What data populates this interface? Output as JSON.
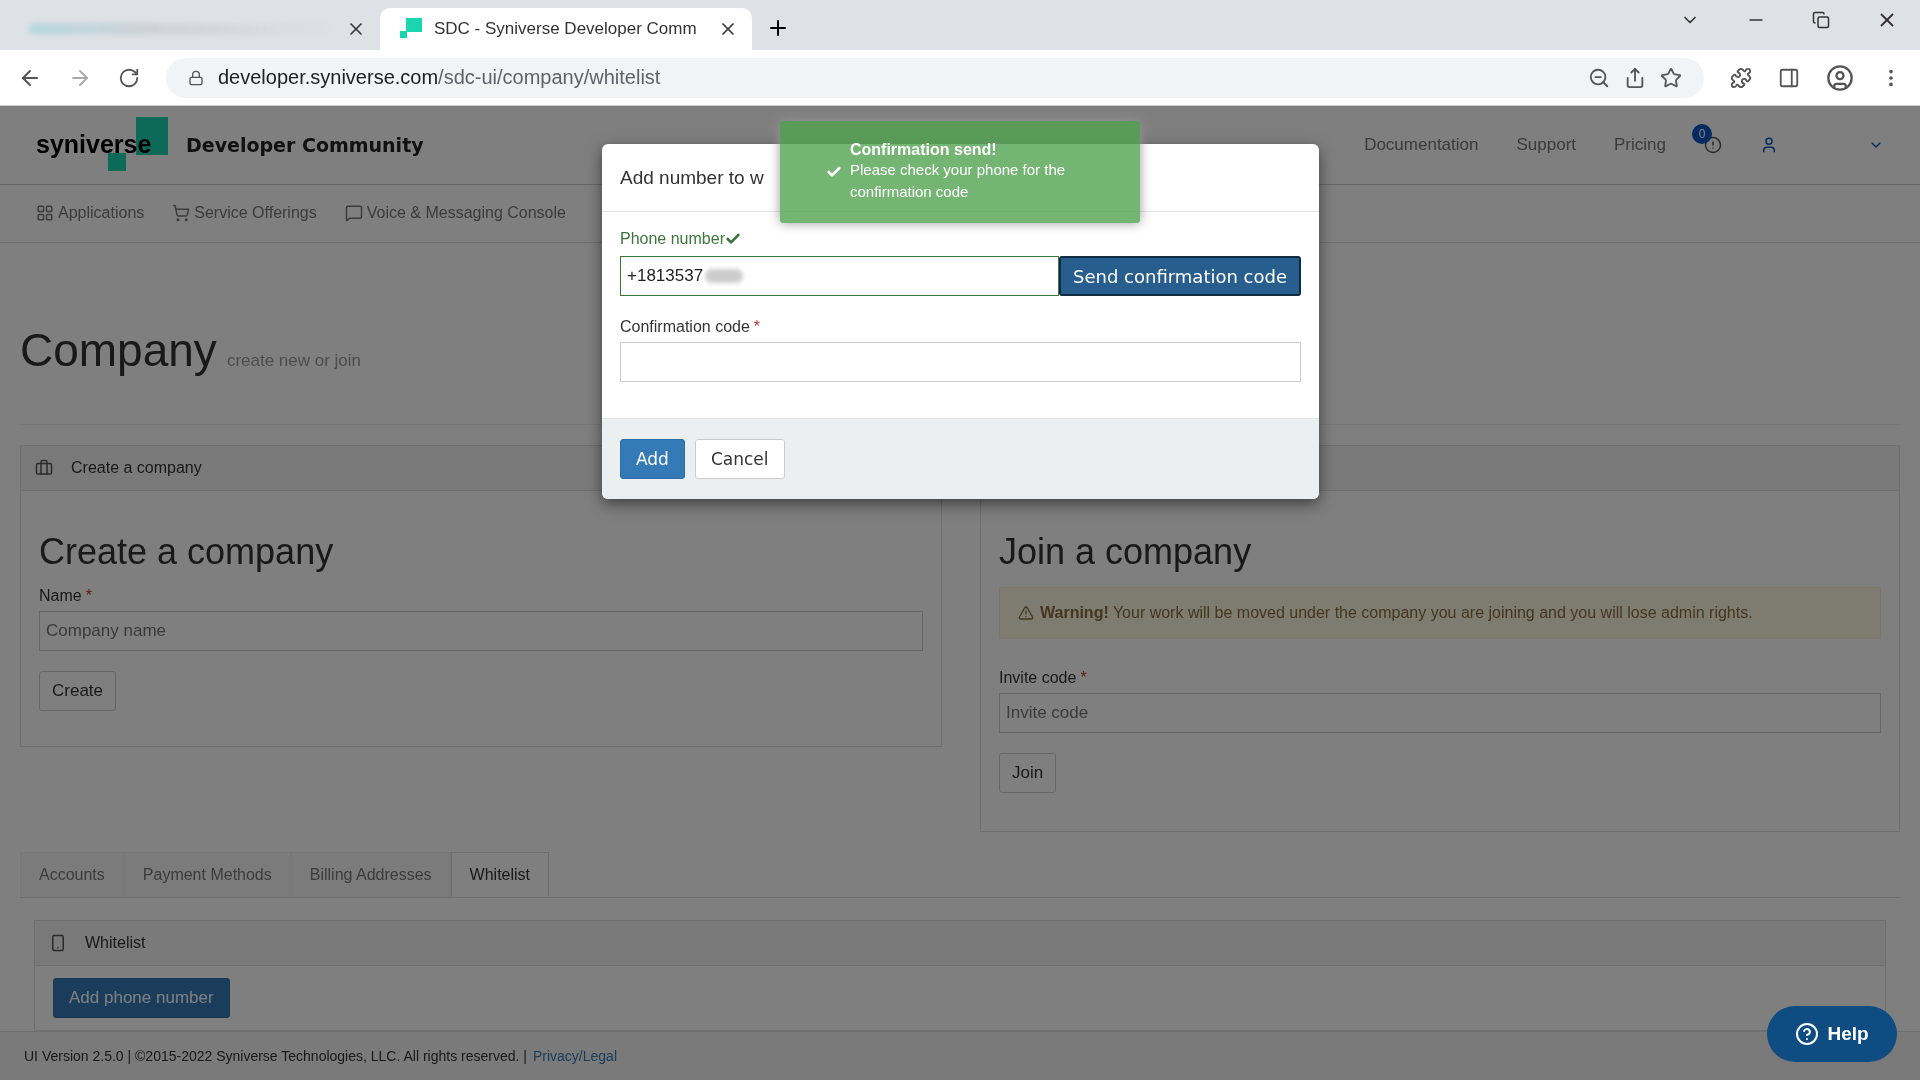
{
  "browser": {
    "tabs": [
      {
        "selected": false
      },
      {
        "title": "SDC - Syniverse Developer Comm",
        "selected": true
      }
    ],
    "url_host": "developer.syniverse.com",
    "url_path": "/sdc-ui/company/whitelist"
  },
  "header": {
    "logo": "syniverse",
    "title": "Developer Community",
    "links": [
      "Documentation",
      "Support",
      "Pricing"
    ],
    "notification_count": "0"
  },
  "nav": [
    {
      "kind": "grid",
      "label": "Applications"
    },
    {
      "kind": "cart",
      "label": "Service Offerings"
    },
    {
      "kind": "chat",
      "label": "Voice & Messaging Console"
    }
  ],
  "page_title": "Company",
  "page_subtitle": "create new or join",
  "create_panel": {
    "heading": "Create a company",
    "title": "Create a company",
    "name_label": "Name",
    "required_mark": "*",
    "placeholder": "Company name",
    "button": "Create"
  },
  "join_panel": {
    "title": "Join a company",
    "warning": "**Warning!** Your work will be moved under the company you are joining and you will lose admin rights.",
    "invite_label": "Invite code",
    "required_mark": "*",
    "placeholder": "Invite code",
    "button": "Join"
  },
  "tabs": [
    {
      "label": "Accounts",
      "selected": false
    },
    {
      "label": "Payment Methods",
      "selected": false
    },
    {
      "label": "Billing Addresses",
      "selected": false
    },
    {
      "label": "Whitelist",
      "selected": true
    }
  ],
  "whitelist_panel": {
    "heading": "Whitelist",
    "button": "Add phone number"
  },
  "footer": {
    "text": "UI Version 2.5.0 | ©2015-2022 Syniverse Technologies, LLC. All rights reserved. |",
    "link": "Privacy/Legal"
  },
  "help": "Help",
  "modal": {
    "title": "Add number to w",
    "phone_label": "Phone number",
    "phone_valid": true,
    "phone_value": "+1813537",
    "send_button": "Send confirmation code",
    "code_label": "Confirmation code",
    "required_mark": "*",
    "buttons": [
      "Add",
      "Cancel"
    ]
  },
  "toast": {
    "title": "Confirmation send!",
    "message": "Please check your phone for the confirmation code"
  }
}
